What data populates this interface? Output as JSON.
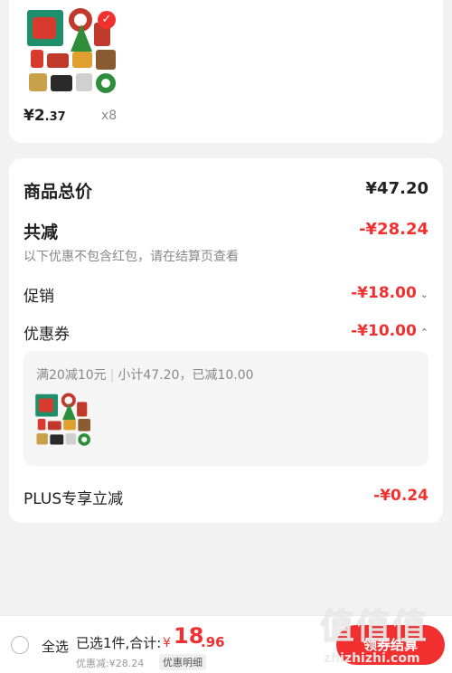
{
  "item": {
    "price_int": "¥2",
    "price_dec": ".37",
    "quantity": "x8"
  },
  "summary": {
    "total_label": "商品总价",
    "total_value": "¥47.20",
    "reduce_label": "共减",
    "reduce_value": "-¥28.24",
    "note": "以下优惠不包含红包，请在结算页查看",
    "promo_label": "促销",
    "promo_value": "-¥18.00",
    "coupon_label": "优惠券",
    "coupon_value": "-¥10.00",
    "coupon_detail": {
      "rule": "满20减10元",
      "subtotal": "小计47.20，已减10.00"
    },
    "plus_label": "PLUS专享立减",
    "plus_value": "-¥0.24"
  },
  "bottom_bar": {
    "select_all": "全选",
    "selected_text": "已选1件,合计:",
    "currency": "¥",
    "total_int": "18",
    "total_dec": ".96",
    "discount_text": "优惠减:¥28.24",
    "detail_button": "优惠明细",
    "checkout_button": "领券结算"
  },
  "watermark": {
    "main": "值值值",
    "site": "zhizhizhi.com"
  },
  "colors": {
    "accent_red": "#f23030",
    "background": "#f2f2f2"
  },
  "icons": {
    "expand": "chevron-down-icon",
    "collapse": "chevron-up-icon",
    "checked": "check-badge-icon",
    "radio": "radio-icon"
  }
}
